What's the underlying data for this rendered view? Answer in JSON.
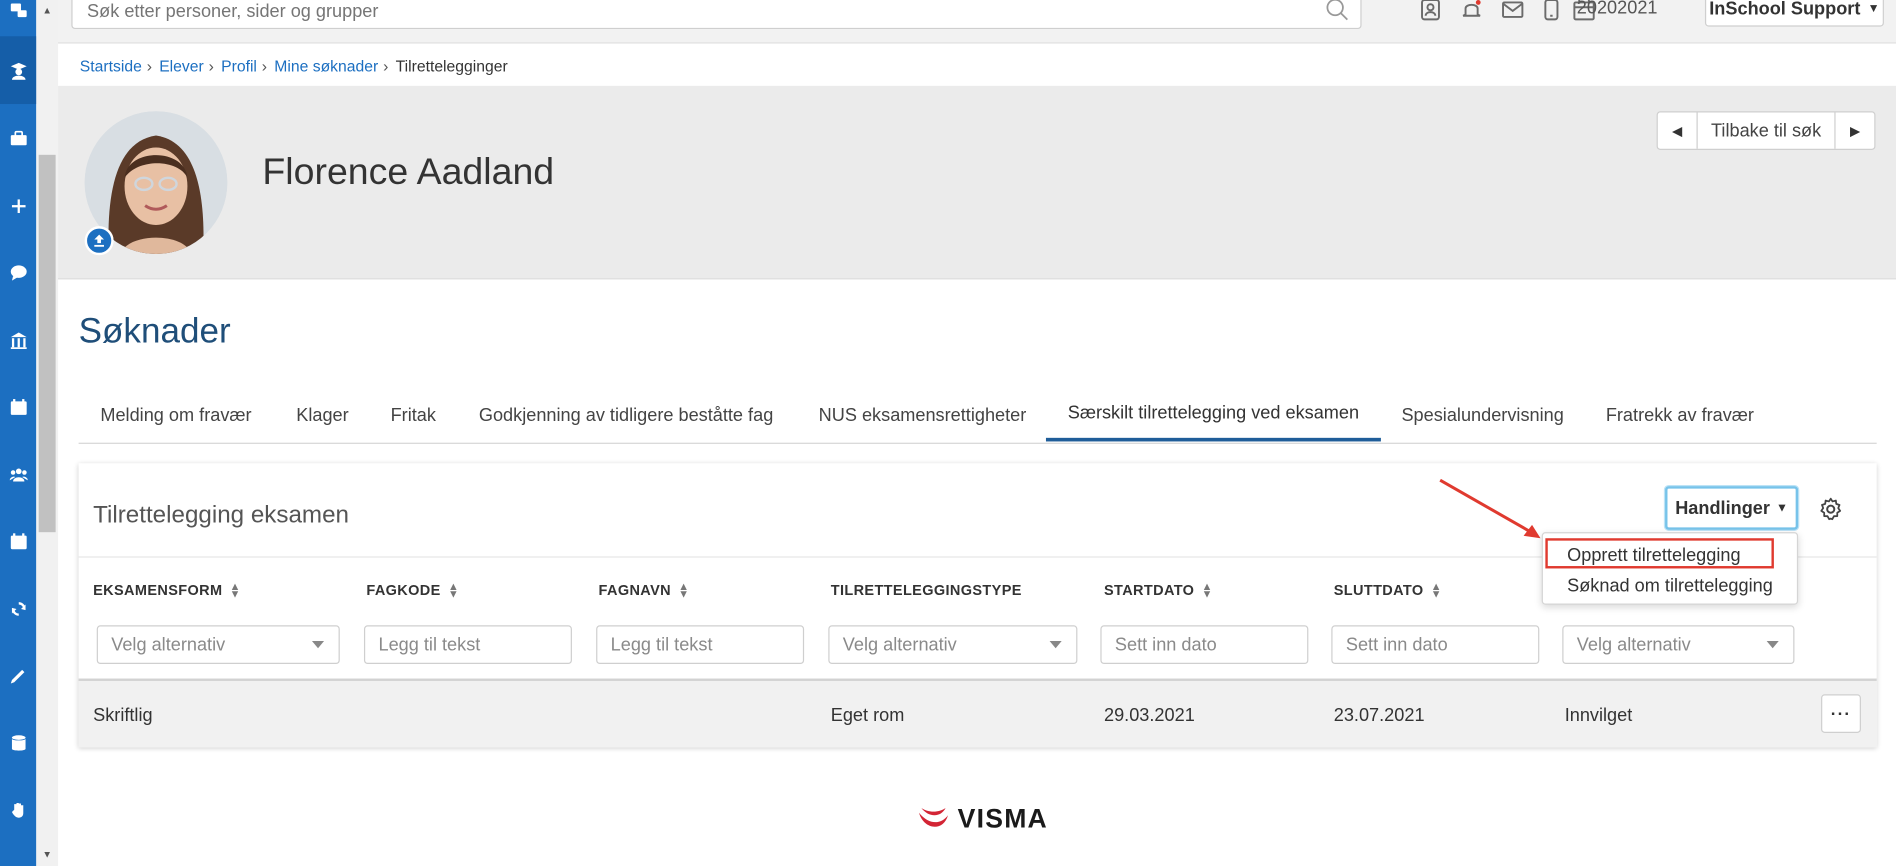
{
  "topbar": {
    "search_placeholder": "Søk etter personer, sider og grupper",
    "school_year": "20202021",
    "user_menu_label": "InSchool Support"
  },
  "sidebar": {
    "items": [
      {
        "icon": "switch-role-icon"
      },
      {
        "icon": "student-icon",
        "active": true
      },
      {
        "icon": "briefcase-icon"
      },
      {
        "icon": "plus-icon"
      },
      {
        "icon": "chat-bubble-icon"
      },
      {
        "icon": "school-building-icon"
      },
      {
        "icon": "calendar-icon"
      },
      {
        "icon": "people-group-icon"
      },
      {
        "icon": "calendar-check-icon"
      },
      {
        "icon": "sync-icon"
      },
      {
        "icon": "pencil-icon"
      },
      {
        "icon": "database-icon"
      },
      {
        "icon": "hand-icon"
      }
    ]
  },
  "breadcrumb": {
    "items": [
      "Startside",
      "Elever",
      "Profil",
      "Mine søknader"
    ],
    "current": "Tilretteleggingerr"
  },
  "profile": {
    "name": "Florence Aadland",
    "back_to_search": "Tilbake til søk"
  },
  "page": {
    "title": "Søknader"
  },
  "tabs": [
    {
      "label": "Melding om fravær"
    },
    {
      "label": "Klager"
    },
    {
      "label": "Fritak"
    },
    {
      "label": "Godkjenning av tidligere beståtte fag"
    },
    {
      "label": "NUS eksamensrettigheter"
    },
    {
      "label": "Særskilt tilrettelegging ved eksamen",
      "active": true
    },
    {
      "label": "Spesialundervisning"
    },
    {
      "label": "Fratrekk av fravær"
    }
  ],
  "card": {
    "title": "Tilrettelegging eksamen",
    "actions_label": "Handlinger",
    "columns": [
      "EKSAMENSFORM",
      "FAGKODE",
      "FAGNAVN",
      "TILRETTELEGGINGSTYPE",
      "STARTDATO",
      "SLUTTDATO"
    ],
    "filters": {
      "select_placeholder": "Velg alternativ",
      "text_placeholder": "Legg til tekst",
      "date_placeholder": "Sett inn dato"
    },
    "rows": [
      {
        "eksamensform": "Skriftlig",
        "fagkode": "",
        "fagnavn": "",
        "type": "Eget rom",
        "start": "29.03.2021",
        "slutt": "23.07.2021",
        "status": "Innvilget"
      }
    ]
  },
  "actions_menu": {
    "items": [
      "Opprett tilrettelegging",
      "Søknad om tilrettelegging"
    ]
  },
  "footer": {
    "logo_text": "VISMA"
  },
  "colors": {
    "sidebar": "#1c6fc1",
    "link": "#1c6fc1",
    "title": "#1f4e79",
    "highlight_box": "#e03a2f",
    "active_tab_underline": "#1f5d99"
  }
}
